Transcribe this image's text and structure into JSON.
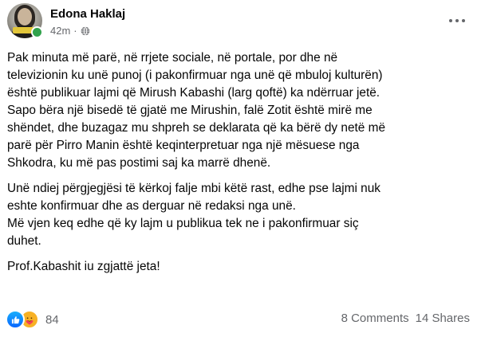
{
  "post": {
    "author": "Edona Haklaj",
    "time": "42m",
    "separator": "·",
    "audience_icon": "globe-icon",
    "paragraphs": [
      {
        "lines": [
          "Pak minuta më parë, në rrjete sociale, në portale, por dhe në",
          "televizionin ku unë punoj (i pakonfirmuar nga unë që mbuloj kulturën)",
          "është publikuar lajmi që Mirush Kabashi (larg qoftë) ka ndërruar jetë.",
          "Sapo bëra një bisedë të gjatë me Mirushin, falë Zotit është mirë me",
          "shëndet, dhe buzagaz mu shpreh se deklarata që ka bërë dy netë më",
          "parë për Pirro Manin është keqinterpretuar nga një mësuese nga",
          "Shkodra, ku më pas postimi saj ka marrë dhenë."
        ]
      },
      {
        "lines": [
          "Unë ndiej përgjegjësi të kërkoj falje mbi këtë rast, edhe pse lajmi nuk",
          "eshte konfirmuar dhe as derguar në redaksi nga unë.",
          "Më vjen keq edhe që ky lajm u publikua tek ne i pakonfirmuar siç",
          "duhet."
        ]
      },
      {
        "lines": [
          "Prof.Kabashit iu zgjattë jeta!"
        ]
      }
    ]
  },
  "footer": {
    "reaction_icons": [
      "like-reaction-icon",
      "care-reaction-icon"
    ],
    "reaction_count": "84",
    "comments": "8 Comments",
    "shares": "14 Shares"
  },
  "colors": {
    "text": "#050505",
    "secondary": "#65676b",
    "like_blue": "#0866ff",
    "care_yellow": "#f7b125",
    "online_green": "#31a24c"
  }
}
